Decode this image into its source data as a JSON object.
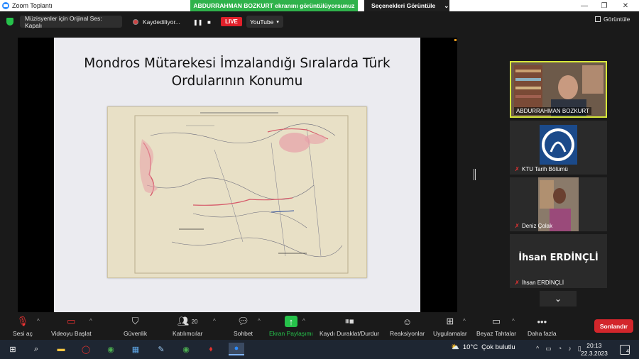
{
  "window": {
    "title": "Zoom Toplantı",
    "share_banner": "ABDURRAHMAN BOZKURT ekranını görüntülüyorsunuz",
    "view_options": "Seçenekleri Görüntüle"
  },
  "topbar": {
    "musician_audio": "Müzisyenler için Orijinal Ses: Kapalı",
    "recording": "Kaydediliyor...",
    "live_badge": "LIVE",
    "stream_target": "YouTube",
    "view_label": "Görüntüle"
  },
  "slide": {
    "title_line1": "Mondros Mütarekesi İmzalandığı Sıralarda Türk",
    "title_line2": "Ordularının Konumu"
  },
  "participants": [
    {
      "name": "ABDURRAHMAN BOZKURT",
      "muted": false,
      "active_speaker": true
    },
    {
      "name": "KTU Tarih Bölümü",
      "muted": true
    },
    {
      "name": "Deniz Çolak",
      "muted": true
    },
    {
      "name": "İhsan ERDİNÇLİ",
      "card_text": "İhsan ERDİNÇLİ",
      "muted": true
    }
  ],
  "toolbar": {
    "unmute": "Sesi aç",
    "start_video": "Videoyu Başlat",
    "security": "Güvenlik",
    "participants": "Katılımcılar",
    "participants_count": "20",
    "chat": "Sohbet",
    "share_screen": "Ekran Paylaşımı",
    "pause_stop": "Kaydı Duraklat/Durdur",
    "reactions": "Reaksiyonlar",
    "apps": "Uygulamalar",
    "whiteboards": "Beyaz Tahtalar",
    "more": "Daha fazla",
    "end": "Sonlandır"
  },
  "taskbar": {
    "temperature": "10°C",
    "weather": "Çok bulutlu",
    "time": "20:13",
    "date": "22.3.2023",
    "notifications": "4"
  },
  "colors": {
    "share_banner": "#2fb24b",
    "live": "#e0202a",
    "end_button": "#d3262b",
    "active_speaker_border": "#d8e83a"
  }
}
